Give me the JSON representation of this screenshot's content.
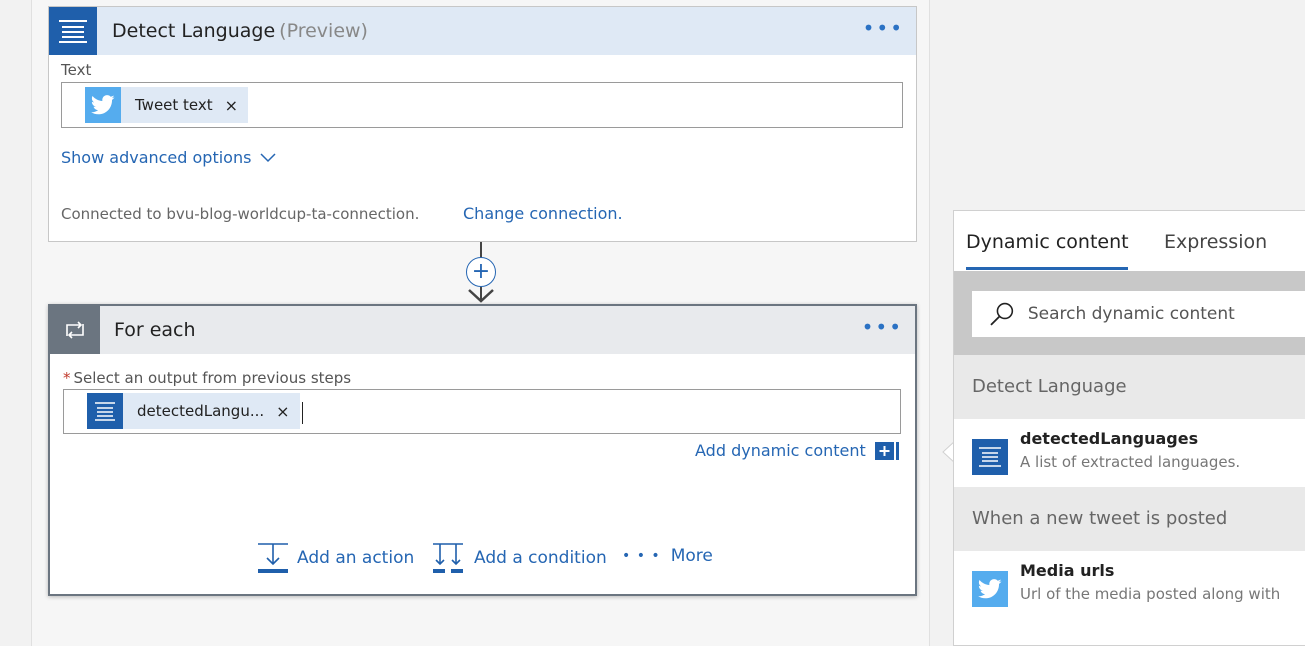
{
  "detect_card": {
    "title": "Detect Language",
    "preview_tag": "(Preview)",
    "more_dots": "•••",
    "text_label": "Text",
    "token_label": "Tweet text",
    "token_remove": "×",
    "advanced_link": "Show advanced options",
    "connected_text": "Connected to bvu-blog-worldcup-ta-connection.",
    "change_connection": "Change connection."
  },
  "connector": {
    "plus": "+"
  },
  "foreach_card": {
    "title": "For each",
    "more_dots": "•••",
    "required_mark": "*",
    "select_label": "Select an output from previous steps",
    "token_label": "detectedLangu...",
    "token_remove": "×",
    "add_dynamic": "Add dynamic content",
    "actions": {
      "add_action": "Add an action",
      "add_condition": "Add a condition",
      "more_dots": "• • •",
      "more": "More"
    }
  },
  "dynamic_panel": {
    "tabs": {
      "dynamic": "Dynamic content",
      "expression": "Expression"
    },
    "search_placeholder": "Search dynamic content",
    "groups": [
      {
        "header": "Detect Language",
        "items": [
          {
            "title": "detectedLanguages",
            "desc": "A list of extracted languages.",
            "icon": "lines-icon"
          }
        ]
      },
      {
        "header": "When a new tweet is posted",
        "items": [
          {
            "title": "Media urls",
            "desc": "Url of the media posted along with",
            "icon": "twitter-bird-icon"
          }
        ]
      }
    ]
  },
  "colors": {
    "accent": "#2566b3",
    "action_blue": "#1f5fab",
    "twitter_blue": "#55acee",
    "loop_gray": "#6b7580"
  }
}
